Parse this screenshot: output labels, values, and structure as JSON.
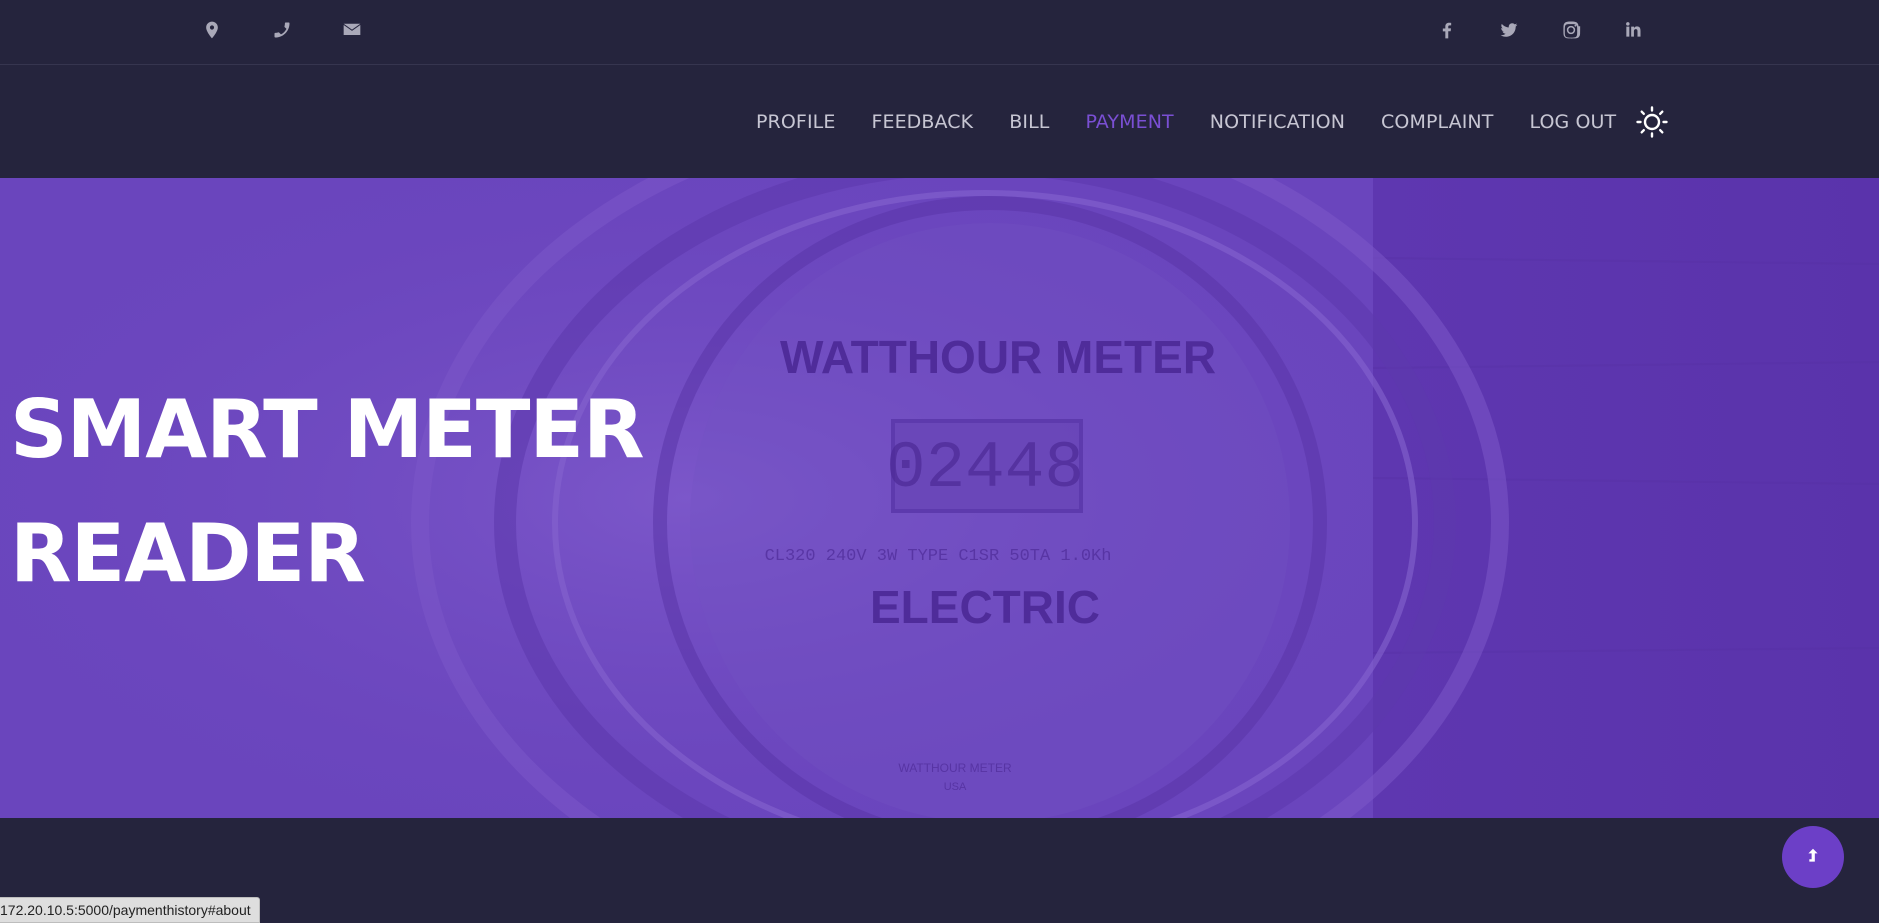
{
  "topbar": {
    "contact_icons": [
      "map-marker-icon",
      "phone-icon",
      "envelope-icon"
    ],
    "social_icons": [
      "facebook-icon",
      "twitter-icon",
      "instagram-icon",
      "linkedin-icon"
    ]
  },
  "nav": {
    "items": [
      {
        "label": "PROFILE"
      },
      {
        "label": "FEEDBACK"
      },
      {
        "label": "BILL"
      },
      {
        "label": "PAYMENT",
        "active": true
      },
      {
        "label": "NOTIFICATION"
      },
      {
        "label": "COMPLAINT"
      },
      {
        "label": "LOG OUT"
      }
    ],
    "theme_toggle_icon": "sun-icon"
  },
  "hero": {
    "title_line1": "SMART METER",
    "title_line2": "READER",
    "meter_text_top": "WATTHOUR METER",
    "meter_digits": "02448",
    "meter_spec": "CL320 240V 3W TYPE C1SR 50TA 1.0Kh",
    "meter_text_bottom": "ELECTRIC",
    "meter_small_1": "WATTHOUR METER",
    "meter_small_2": "USA"
  },
  "back_to_top_icon": "arrow-up-icon",
  "status_bar": {
    "url": "172.20.10.5:5000/paymenthistory#about"
  },
  "colors": {
    "background": "#25243d",
    "accent": "#7a4fd3",
    "hero_overlay": "#6a45bd",
    "nav_text": "#c7c6d3"
  }
}
